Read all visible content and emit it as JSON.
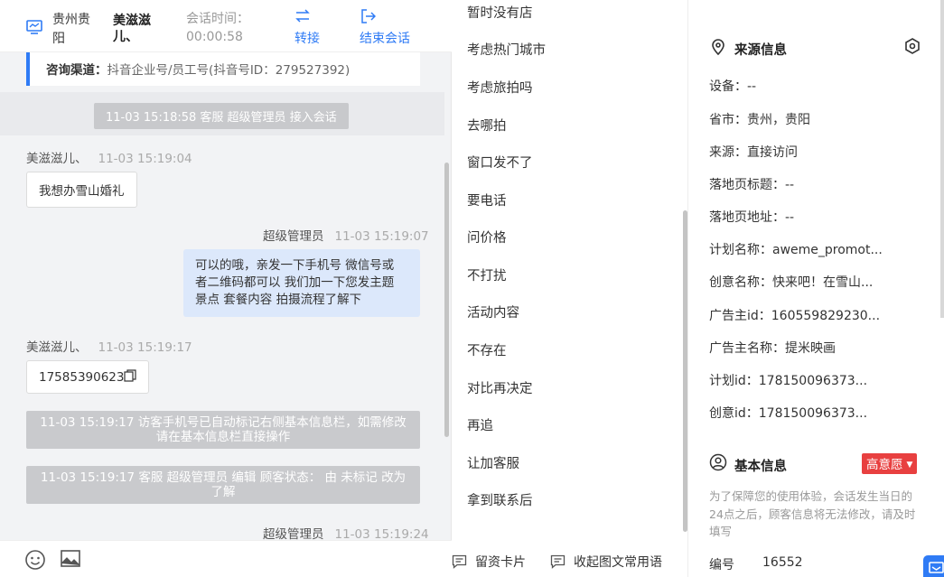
{
  "header": {
    "region": "贵州贵阳",
    "visitor_name": "美滋滋儿、",
    "session_time_label": "会话时间：",
    "session_time_value": "00:00:58",
    "transfer_label": "转接",
    "end_label": "结束会话",
    "accent_color": "#2f7bf5"
  },
  "chat": {
    "consult_label": "咨询渠道：",
    "consult_value": "抖音企业号/员工号(抖音号ID：279527392)",
    "join_notice": "11-03 15:18:58 客服 超级管理员 接入会话",
    "messages": [
      {
        "sender": "美滋滋儿、",
        "time": "11-03 15:19:04",
        "text": "我想办雪山婚礼"
      },
      {
        "sender": "超级管理员",
        "time": "11-03 15:19:07",
        "lines": [
          "可以的哦，亲发一下手机号 微信号或",
          "者二维码都可以 我们加一下您发主题",
          "景点 套餐内容 拍摄流程了解下"
        ]
      },
      {
        "sender": "美滋滋儿、",
        "time": "11-03 15:19:17",
        "text": "17585390623"
      },
      {
        "sender": "超级管理员",
        "time": "11-03 15:19:24"
      }
    ],
    "system_notices": [
      {
        "line1": "11-03 15:19:17 访客手机号已自动标记右侧基本信息栏，如需修改",
        "line2": "请在基本信息栏直接操作"
      },
      {
        "line1": "11-03 15:19:17 客服 超级管理员 编辑 顾客状态： 由 未标记 改为",
        "line2": "了解"
      }
    ],
    "footer_icons": [
      "emoji-icon",
      "image-icon"
    ]
  },
  "quick_replies": {
    "items": [
      "暂时没有店",
      "考虑热门城市",
      "考虑旅拍吗",
      "去哪拍",
      "窗口发不了",
      "要电话",
      "问价格",
      "不打扰",
      "活动内容",
      "不存在",
      "对比再决定",
      "再追",
      "让加客服",
      "拿到联系后"
    ],
    "footer_card_label": "留资卡片",
    "footer_collapse_label": "收起图文常用语"
  },
  "info": {
    "source_title": "来源信息",
    "rows": [
      "设备：--",
      "省市：贵州，贵阳",
      "来源：直接访问",
      "落地页标题：--",
      "落地页地址：--",
      "计划名称：aweme_promot...",
      "创意名称：快来吧！在雪山...",
      "广告主id：160559829230...",
      "广告主名称：提米映画",
      "计划id：178150096373...",
      "创意id：178150096373..."
    ],
    "basic_title": "基本信息",
    "intent_badge": "高意愿",
    "note": "为了保障您的使用体验，会话发生当日的24点之后，顾客信息将无法修改，请及时填写",
    "id_label": "编号",
    "id_value": "16552",
    "badge_color": "#e84040"
  }
}
